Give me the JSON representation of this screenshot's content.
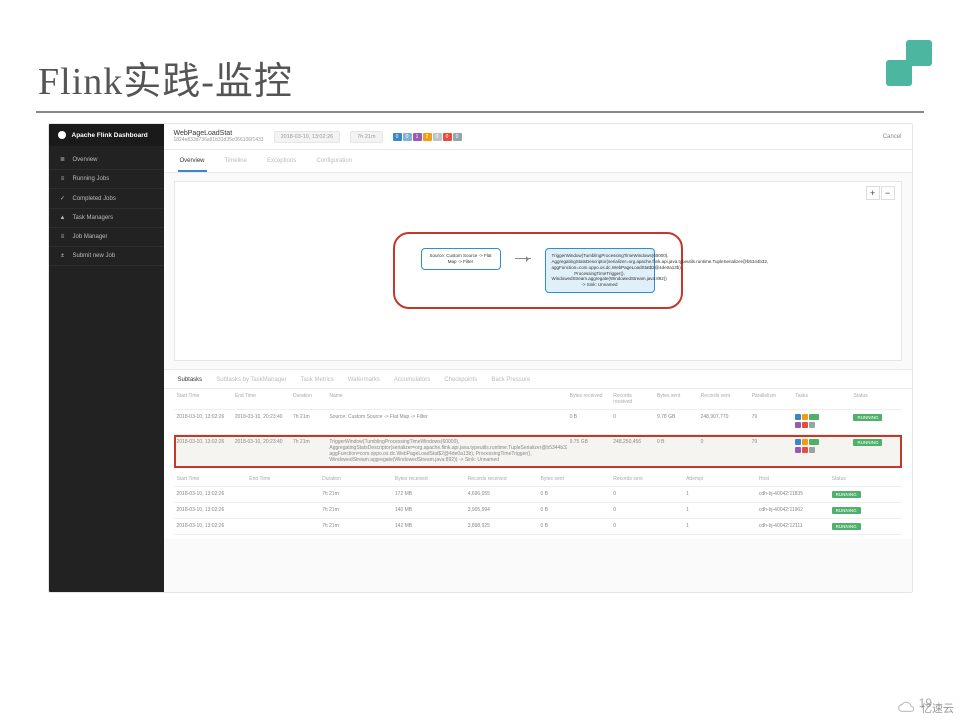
{
  "slide": {
    "title": "Flink实践-监控",
    "page": "19",
    "watermark": "亿速云"
  },
  "sidebar": {
    "brand": "Apache Flink Dashboard",
    "items": [
      {
        "icon": "≣",
        "label": "Overview"
      },
      {
        "icon": "≡",
        "label": "Running Jobs"
      },
      {
        "icon": "✓",
        "label": "Completed Jobs"
      },
      {
        "icon": "▲",
        "label": "Task Managers"
      },
      {
        "icon": "≡",
        "label": "Job Manager"
      },
      {
        "icon": "±",
        "label": "Submit new Job"
      }
    ]
  },
  "job": {
    "name": "WebPageLoadStat",
    "id": "1824e833d736a91b31d35c066106f1433",
    "time": "2018-03-10, 13:02:26",
    "duration": "7h 21m",
    "badges": [
      {
        "v": "0",
        "c": "#3a86c8"
      },
      {
        "v": "0",
        "c": "#7fb3d5"
      },
      {
        "v": "1",
        "c": "#9b59b6"
      },
      {
        "v": "2",
        "c": "#f39c12"
      },
      {
        "v": "0",
        "c": "#bdc3c7"
      },
      {
        "v": "0",
        "c": "#e74c3c"
      },
      {
        "v": "0",
        "c": "#95a5a6"
      }
    ],
    "cancel": "Cancel"
  },
  "tabs": {
    "items": [
      "Overview",
      "Timeline",
      "Exceptions",
      "Configuration"
    ],
    "active": 0
  },
  "graph": {
    "nodeA": "Source: Custom Source -> Flat Map -> Filter",
    "nodeB": "TriggerWindow(TumblingProcessingTimeWindows(60000), AggregatingStatsDescriptor(serializer=org.apache.flink.api.java.typeutils.runtime.TupleSerializer@b5344b32, aggFunction=com.oppo.os.dc.WebPageLoadStat$2@4de0a13b), ProcessingTimeTrigger(), WindowedStream.aggregate(WindowedStream.java:892)) -> Sink: Unnamed"
  },
  "subtabs": {
    "items": [
      "Subtasks",
      "Subtasks by TaskManager",
      "Task Metrics",
      "Watermarks",
      "Accumulators",
      "Checkpoints",
      "Back Pressure"
    ],
    "active": 0
  },
  "mainTable": {
    "headers": [
      "Start Time",
      "End Time",
      "Duration",
      "Name",
      "Bytes received",
      "Records received",
      "Bytes sent",
      "Records sent",
      "Parallelism",
      "Tasks",
      "Status"
    ],
    "rows": [
      {
        "start": "2018-03-10, 13:02:26",
        "end": "2018-03-10, 20:23:40",
        "dur": "7h 21m",
        "name": "Source: Custom Source -> Flat Map -> Filter",
        "br": "0 B",
        "rr": "0",
        "bs": "9.78 GB",
        "rs": "248,907,770",
        "par": "79",
        "status": "RUNNING"
      },
      {
        "start": "2018-03-10, 13:02:26",
        "end": "2018-03-10, 20:23:40",
        "dur": "7h 21m",
        "name": "TriggerWindow(TumblingProcessingTimeWindows(60000), AggregatingStatsDescriptor(serializer=org.apache.flink.api.java.typeutils.runtime.TupleSerializer@b5344b32, aggFunction=com.oppo.os.dc.WebPageLoadStat$2@4de0a13b), ProcessingTimeTrigger(), WindowedStream.aggregate(WindowedStream.java:892)) -> Sink: Unnamed",
        "br": "9.75 GB",
        "rr": "248,250,456",
        "bs": "0 B",
        "rs": "0",
        "par": "79",
        "status": "RUNNING",
        "hl": true
      }
    ]
  },
  "detailTable": {
    "headers": [
      "Start Time",
      "End Time",
      "Duration",
      "Bytes received",
      "Records received",
      "Bytes sent",
      "Records sent",
      "Attempt",
      "Host",
      "Status"
    ],
    "rows": [
      {
        "start": "2018-03-10, 13:02:26",
        "end": "",
        "dur": "7h 21m",
        "br": "172 MB",
        "rr": "4,696,055",
        "bs": "0 B",
        "rs": "0",
        "att": "1",
        "host": "cdh-bj-40042:11835",
        "status": "RUNNING"
      },
      {
        "start": "2018-03-10, 13:02:26",
        "end": "",
        "dur": "7h 21m",
        "br": "140 MB",
        "rr": "3,905,994",
        "bs": "0 B",
        "rs": "0",
        "att": "1",
        "host": "cdh-bj-40042:11962",
        "status": "RUNNING"
      },
      {
        "start": "2018-03-10, 13:02:26",
        "end": "",
        "dur": "7h 21m",
        "br": "142 MB",
        "rr": "3,898,925",
        "bs": "0 B",
        "rs": "0",
        "att": "1",
        "host": "cdh-bj-40042:12111",
        "status": "RUNNING"
      }
    ]
  }
}
